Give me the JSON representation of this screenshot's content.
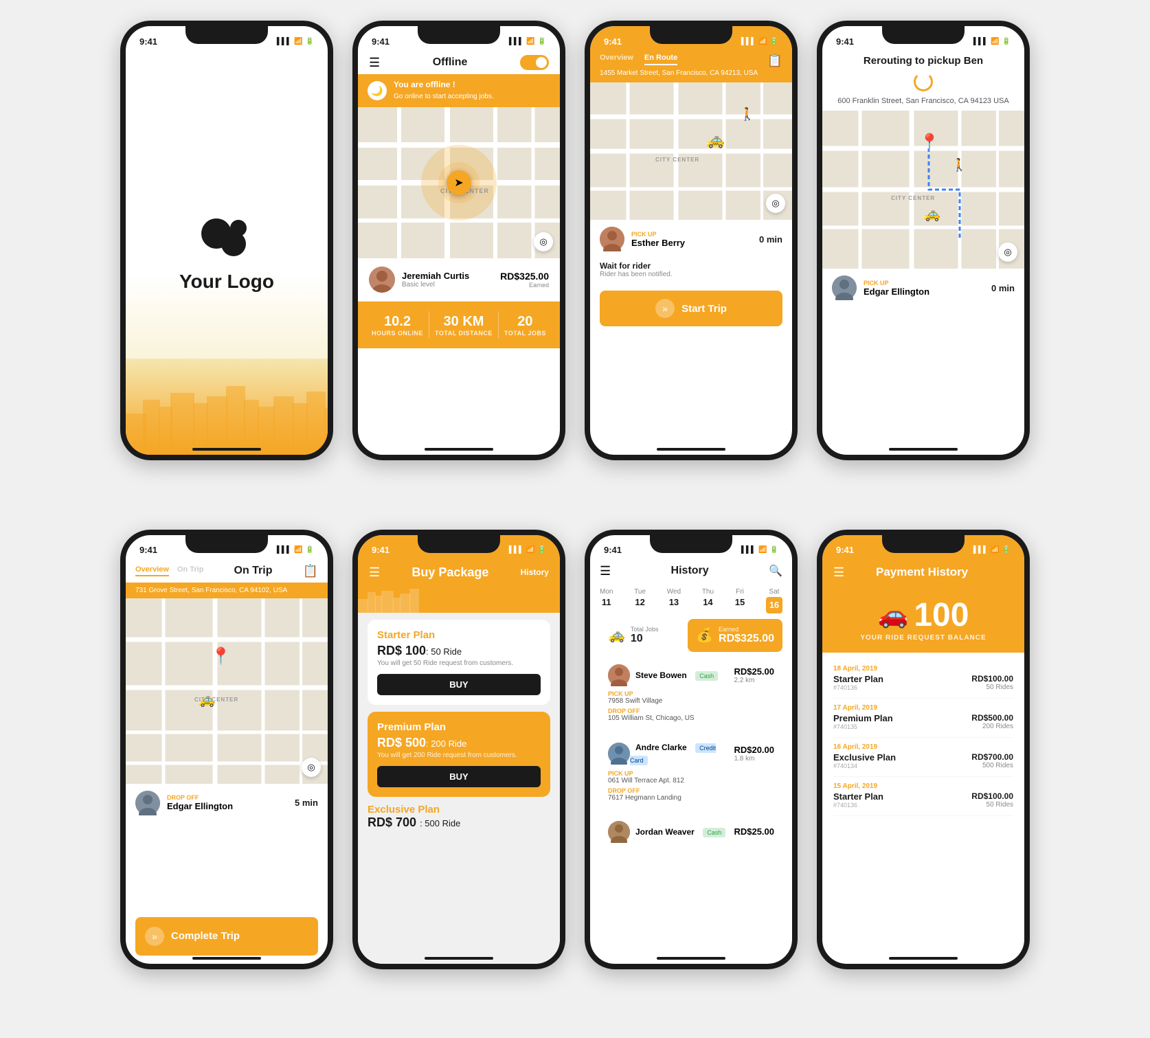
{
  "row1": {
    "phone1": {
      "time": "9:41",
      "logo_text": "Your Logo",
      "tagline": ""
    },
    "phone2": {
      "time": "9:41",
      "title": "Offline",
      "toggle_state": "on",
      "banner_title": "You are offline !",
      "banner_subtitle": "Go online to start accepting jobs.",
      "map_label": "CITY CENTER",
      "driver_name": "Jeremiah Curtis",
      "driver_level": "Basic level",
      "earning_amount": "RD$325.00",
      "earning_label": "Earned",
      "stat1_value": "10.2",
      "stat1_label": "HOURS ONLINE",
      "stat2_value": "30 KM",
      "stat2_label": "TOTAL DISTANCE",
      "stat3_value": "20",
      "stat3_label": "TOTAL JOBS"
    },
    "phone3": {
      "time": "9:41",
      "tab1": "Overview",
      "tab2": "En Route",
      "address": "1455 Market Street, San Francisco, CA 94213, USA",
      "pickup_label": "PICK UP",
      "rider_name": "Esther Berry",
      "eta": "0 min",
      "wait_title": "Wait for rider",
      "wait_subtitle": "Rider has been notified.",
      "start_btn": "Start Trip",
      "map_label": "CITY CENTER"
    },
    "phone4": {
      "time": "9:41",
      "reroute_title": "Rerouting to pickup Ben",
      "reroute_address": "600 Franklin Street, San Francisco, CA 94123 USA",
      "map_label": "CITY CENTER",
      "pickup_label": "PICK UP",
      "rider_name": "Edgar Ellington",
      "eta": "0 min"
    }
  },
  "row2": {
    "phone5": {
      "time": "9:41",
      "tab1": "Overview",
      "tab2": "On Trip",
      "address": "731 Grove Street, San Francisco, CA 94102, USA",
      "map_label": "CITY CENTER",
      "dropoff_label": "DROP OFF",
      "rider_name": "Edgar Ellington",
      "eta": "5 min",
      "complete_btn": "Complete Trip"
    },
    "phone6": {
      "time": "9:41",
      "title": "Buy Package",
      "history_link": "History",
      "plan1_name": "Starter Plan",
      "plan1_price": "RD$ 100",
      "plan1_rides": ": 50 Ride",
      "plan1_desc": "You will get 50 Ride request from customers.",
      "plan1_btn": "BUY",
      "plan2_name": "Premium Plan",
      "plan2_price": "RD$ 500",
      "plan2_rides": ": 200 Ride",
      "plan2_desc": "You will get 200 Ride request from customers.",
      "plan2_btn": "BUY",
      "plan3_name": "Exclusive Plan",
      "plan3_price": "RD$ 700",
      "plan3_rides": ": 500 Ride"
    },
    "phone7": {
      "time": "9:41",
      "title": "History",
      "days": [
        {
          "name": "Mon",
          "num": "11"
        },
        {
          "name": "Tue",
          "num": "12"
        },
        {
          "name": "Wed",
          "num": "13"
        },
        {
          "name": "Thu",
          "num": "14"
        },
        {
          "name": "Fri",
          "num": "15"
        },
        {
          "name": "Sat",
          "num": "16",
          "today": true
        }
      ],
      "total_jobs_label": "Total Jobs",
      "total_jobs": "10",
      "earned_label": "Earned",
      "earned_amount": "RD$325.00",
      "trips": [
        {
          "rider": "Steve Bowen",
          "payment": "Cash",
          "payment_type": "cash",
          "amount": "RD$25.00",
          "distance": "2.2 km",
          "pickup": "7958 Swift Village",
          "dropoff": "105 William St, Chicago, US"
        },
        {
          "rider": "Andre Clarke",
          "payment": "Credit Card",
          "payment_type": "credit",
          "amount": "RD$20.00",
          "distance": "1.8 km",
          "pickup": "061 Will Terrace Apt. 812",
          "dropoff": "7617 Hegmann Landing"
        },
        {
          "rider": "Jordan Weaver",
          "payment": "Cash",
          "payment_type": "cash",
          "amount": "RD$25.00",
          "distance": ""
        }
      ]
    },
    "phone8": {
      "time": "9:41",
      "title": "Payment History",
      "balance": "100",
      "balance_label": "YOUR RIDE REQUEST BALANCE",
      "payments": [
        {
          "plan": "Starter Plan",
          "id": "#740136",
          "date": "18 April, 2019",
          "amount": "RD$100.00",
          "rides": "50 Rides"
        },
        {
          "plan": "Premium Plan",
          "id": "#740135",
          "date": "17 April, 2019",
          "amount": "RD$500.00",
          "rides": "200 Rides"
        },
        {
          "plan": "Exclusive Plan",
          "id": "#740134",
          "date": "16 April, 2019",
          "amount": "RD$700.00",
          "rides": "500 Rides"
        },
        {
          "plan": "Starter Plan",
          "id": "#740136",
          "date": "15 April, 2019",
          "amount": "RD$100.00",
          "rides": "50 Rides"
        }
      ]
    }
  }
}
